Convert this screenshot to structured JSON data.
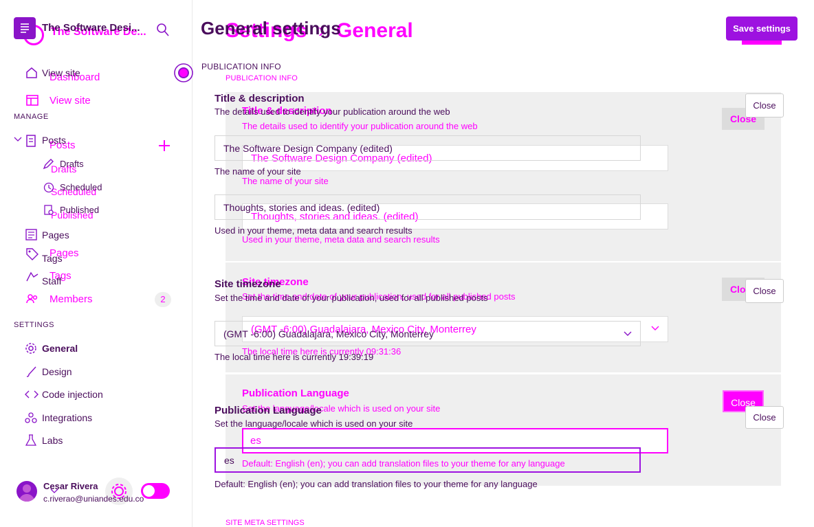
{
  "accent_colors": {
    "primary": "#ff00ff",
    "dark": "#4a0d5c",
    "purple": "#8a14c8"
  },
  "layerA": {
    "sidebar": {
      "site_title": "The Software Desi...",
      "view_site": "View site",
      "manage_heading": "MANAGE",
      "posts": "Posts",
      "drafts": "Drafts",
      "scheduled": "Scheduled",
      "published": "Published",
      "pages": "Pages",
      "tags": "Tags",
      "staff": "Staff",
      "settings_heading": "SETTINGS",
      "general": "General",
      "design": "Design",
      "code_injection": "Code injection",
      "integrations": "Integrations",
      "labs": "Labs",
      "user_name": "Cesar Rivera",
      "user_email": "c.riverao@uniandes.edu.co"
    },
    "main": {
      "page_title": "General settings",
      "save_button": "Save settings",
      "section_label": "PUBLICATION INFO",
      "title_desc_heading": "Title & description",
      "title_desc_sub": "The details used to identify your publication around the web",
      "title_value": "The Software Design Company (edited)",
      "title_help": "The name of your site",
      "description_value": "Thoughts, stories and ideas. (edited)",
      "description_help": "Used in your theme, meta data and search results",
      "close1": "Close",
      "timezone_heading": "Site timezone",
      "timezone_sub": "Set the time and date of your publication, used for all published posts",
      "timezone_value": "(GMT -6:00) Guadalajara, Mexico City, Monterrey",
      "timezone_help": "The local time here is currently 19:39:19",
      "close2": "Close",
      "lang_heading": "Publication Language",
      "lang_sub": "Set the language/locale which is used on your site",
      "lang_value": "es",
      "lang_help": "Default: English (en); you can add translation files to your theme for any language",
      "close3": "Close"
    }
  },
  "layerB": {
    "sidebar": {
      "site_title": "The Software De...",
      "dashboard": "Dashboard",
      "view_site": "View site",
      "posts": "Posts",
      "drafts": "Drafts",
      "scheduled": "Scheduled",
      "published": "Published",
      "pages": "Pages",
      "tags": "Tags",
      "members": "Members",
      "members_count": "2"
    },
    "main": {
      "breadcrumb_settings": "Settings",
      "breadcrumb_sep": "›",
      "breadcrumb_general": "General",
      "save_button": "Save",
      "section_label": "PUBLICATION INFO",
      "title_desc_heading": "Title & description",
      "title_desc_sub": "The details used to identify your publication around the web",
      "title_value": "The Software Design Company (edited)",
      "title_help": "The name of your site",
      "description_value": "Thoughts, stories and ideas. (edited)",
      "description_help": "Used in your theme, meta data and search results",
      "close1": "Close",
      "timezone_heading": "Site timezone",
      "timezone_sub": "Set the time and date of your publication, used for all published posts",
      "timezone_value": "(GMT -6:00) Guadalajara, Mexico City, Monterrey",
      "timezone_help": "The local time here is currently 09:31:36",
      "close2": "Close",
      "lang_heading": "Publication Language",
      "lang_sub": "Set the language/locale which is used on your site",
      "lang_value": "es",
      "lang_help": "Default: English (en); you can add translation files to your theme for any language",
      "close3": "Close",
      "meta_section_label": "SITE META SETTINGS"
    }
  }
}
